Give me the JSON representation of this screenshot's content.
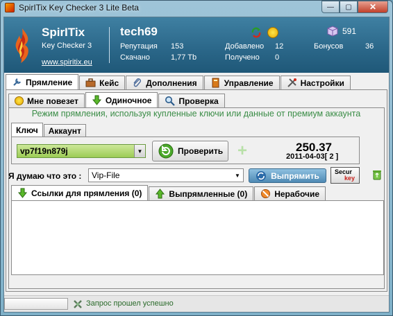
{
  "window": {
    "title": "SpirITix Key Checker 3 Lite Beta",
    "min": "—",
    "max": "▢",
    "close": "✕"
  },
  "header": {
    "brand": "SpirITix",
    "subtitle": "Key Checker 3",
    "site": "www.spiritix.eu",
    "username": "tech69",
    "credits": "591",
    "stats": [
      {
        "label": "Репутация",
        "value": "153"
      },
      {
        "label": "Скачано",
        "value": "1,77 Tb"
      },
      {
        "label": "Добавлено",
        "value": "12"
      },
      {
        "label": "Получено",
        "value": "0"
      },
      {
        "label": "Бонусов",
        "value": "36"
      }
    ]
  },
  "main_tabs": [
    {
      "label": "Прямление",
      "icon": "wrench-icon"
    },
    {
      "label": "Кейс",
      "icon": "briefcase-icon"
    },
    {
      "label": "Дополнения",
      "icon": "paperclip-icon"
    },
    {
      "label": "Управление",
      "icon": "book-icon"
    },
    {
      "label": "Настройки",
      "icon": "tools-icon"
    }
  ],
  "sub_tabs": [
    {
      "label": "Мне повезет",
      "icon": "smile-icon"
    },
    {
      "label": "Одиночное",
      "icon": "green-arrow-icon"
    },
    {
      "label": "Проверка",
      "icon": "magnifier-icon"
    }
  ],
  "banner": "Режим прямления, используя купленные ключи или данные от премиум аккаунта",
  "key_tabs": [
    "Ключ",
    "Аккаунт"
  ],
  "key_value": "vp7f19n879j",
  "check_label": "Проверить",
  "balance": "250.37",
  "balance_date": "2011-04-03[ 2 ]",
  "host_label": "Я думаю что это :",
  "host_value": "Vip-File",
  "fix_label": "Выпрямить",
  "secur": {
    "line1": "Secur",
    "line2": "key"
  },
  "link_tabs": [
    {
      "label": "Ссылки для прямления (0)",
      "icon": "down-arrow-icon"
    },
    {
      "label": "Выпрямленные (0)",
      "icon": "up-arrow-icon"
    },
    {
      "label": "Нерабочие",
      "icon": "forbidden-icon"
    }
  ],
  "status": "Запрос прошел успешно",
  "colors": {
    "header": "#2a6688",
    "accent_green": "#3a8c46",
    "key_bg": "#9ccc55",
    "fix_button": "#4f8ab4"
  }
}
